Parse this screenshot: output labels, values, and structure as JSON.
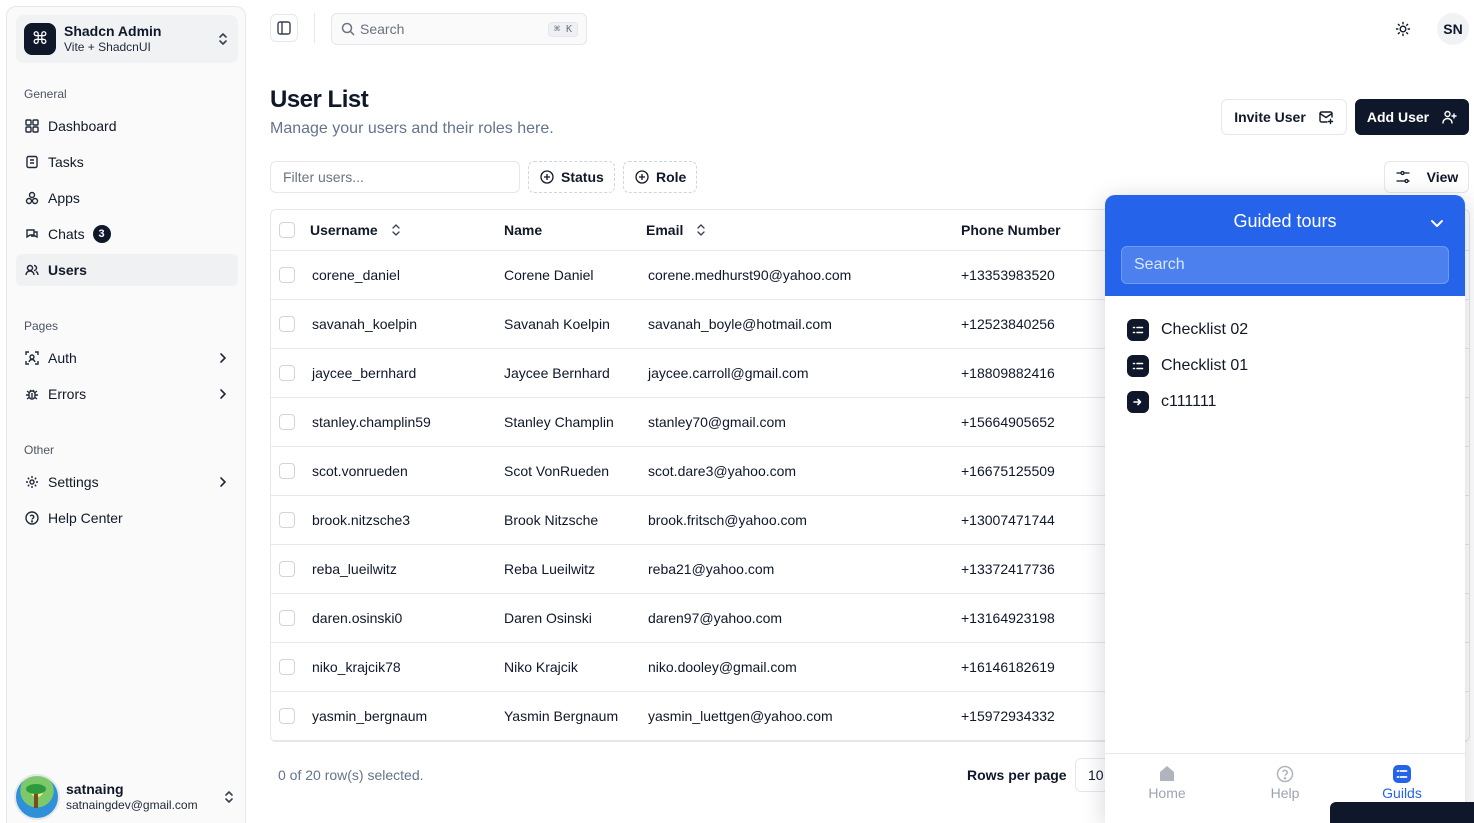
{
  "team": {
    "name": "Shadcn Admin",
    "subtitle": "Vite + ShadcnUI"
  },
  "nav": {
    "general_title": "General",
    "general": [
      {
        "label": "Dashboard",
        "icon": "dashboard-icon"
      },
      {
        "label": "Tasks",
        "icon": "tasks-icon"
      },
      {
        "label": "Apps",
        "icon": "apps-icon"
      },
      {
        "label": "Chats",
        "icon": "chats-icon",
        "badge": "3"
      },
      {
        "label": "Users",
        "icon": "users-icon",
        "active": true
      }
    ],
    "pages_title": "Pages",
    "pages": [
      {
        "label": "Auth",
        "icon": "auth-icon"
      },
      {
        "label": "Errors",
        "icon": "errors-icon"
      }
    ],
    "other_title": "Other",
    "other": [
      {
        "label": "Settings",
        "icon": "settings-icon"
      },
      {
        "label": "Help Center",
        "icon": "help-icon"
      }
    ]
  },
  "user": {
    "name": "satnaing",
    "email": "satnaingdev@gmail.com",
    "initials": "SN"
  },
  "header": {
    "search_placeholder": "Search",
    "shortcut": "⌘ K"
  },
  "page": {
    "title": "User List",
    "subtitle": "Manage your users and their roles here.",
    "invite_label": "Invite User",
    "add_label": "Add User"
  },
  "toolbar": {
    "filter_placeholder": "Filter users...",
    "status_label": "Status",
    "role_label": "Role",
    "view_label": "View"
  },
  "table": {
    "columns": [
      "Username",
      "Name",
      "Email",
      "Phone Number"
    ],
    "rows": [
      [
        "corene_daniel",
        "Corene Daniel",
        "corene.medhurst90@yahoo.com",
        "+13353983520"
      ],
      [
        "savanah_koelpin",
        "Savanah Koelpin",
        "savanah_boyle@hotmail.com",
        "+12523840256"
      ],
      [
        "jaycee_bernhard",
        "Jaycee Bernhard",
        "jaycee.carroll@gmail.com",
        "+18809882416"
      ],
      [
        "stanley.champlin59",
        "Stanley Champlin",
        "stanley70@gmail.com",
        "+15664905652"
      ],
      [
        "scot.vonrueden",
        "Scot VonRueden",
        "scot.dare3@yahoo.com",
        "+16675125509"
      ],
      [
        "brook.nitzsche3",
        "Brook Nitzsche",
        "brook.fritsch@yahoo.com",
        "+13007471744"
      ],
      [
        "reba_lueilwitz",
        "Reba Lueilwitz",
        "reba21@yahoo.com",
        "+13372417736"
      ],
      [
        "daren.osinski0",
        "Daren Osinski",
        "daren97@yahoo.com",
        "+13164923198"
      ],
      [
        "niko_krajcik78",
        "Niko Krajcik",
        "niko.dooley@gmail.com",
        "+16146182619"
      ],
      [
        "yasmin_bergnaum",
        "Yasmin Bergnaum",
        "yasmin_luettgen@yahoo.com",
        "+15972934332"
      ]
    ],
    "selected_text": "0 of 20 row(s) selected.",
    "rows_per_page_label": "Rows per page",
    "rows_per_page_value": "10"
  },
  "tours": {
    "title": "Guided tours",
    "search_placeholder": "Search",
    "items": [
      {
        "label": "Checklist 02",
        "icon": "checklist-icon"
      },
      {
        "label": "Checklist 01",
        "icon": "checklist-icon"
      },
      {
        "label": "c111111",
        "icon": "tour-enter-icon"
      }
    ],
    "nav": [
      "Home",
      "Help",
      "Guilds"
    ],
    "active_nav": "Guilds"
  },
  "colors": {
    "accent": "#2563eb",
    "primary_dark": "#0f172a",
    "border": "#e5e7eb"
  }
}
